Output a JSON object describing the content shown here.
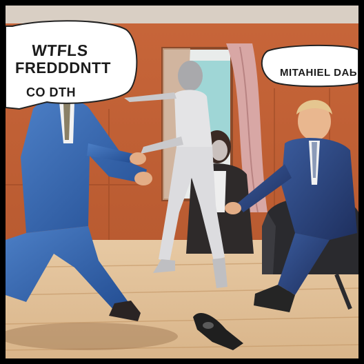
{
  "bubbles": [
    {
      "lines": [
        "WTFLS",
        "FREDDDNTT",
        "CO       DTH"
      ]
    },
    {
      "lines": [
        "MITAHIEL DAЬ"
      ]
    }
  ]
}
